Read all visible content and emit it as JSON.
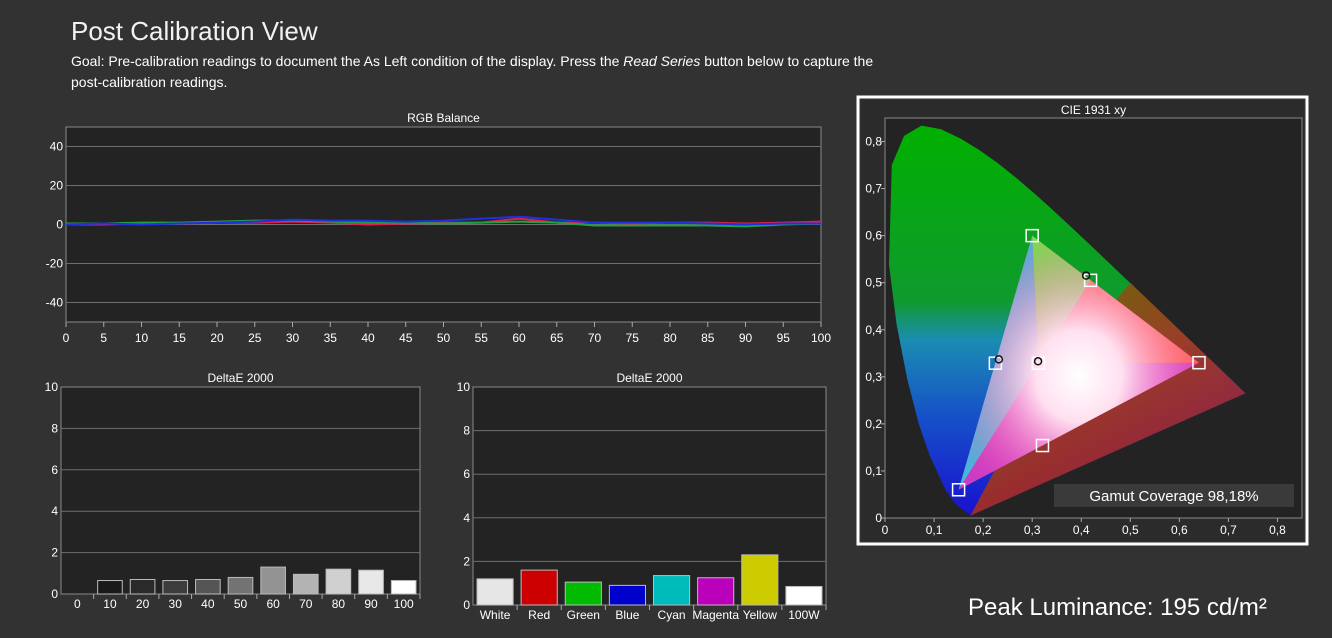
{
  "header": {
    "title": "Post Calibration View",
    "goal_prefix": "Goal: Pre-calibration readings to document the As Left condition of the display. Press the ",
    "goal_italic": "Read Series",
    "goal_suffix": " button below to capture the post-calibration readings."
  },
  "peak_luminance": "Peak Luminance: 195 cd/m²",
  "colors": {
    "background": "#323232",
    "plot_background": "#232323",
    "gridline": "#6e6e6e",
    "red_series": "#e0204a",
    "green_series": "#20a040",
    "blue_series": "#2030e0"
  },
  "chart_data": [
    {
      "type": "line",
      "title": "RGB Balance",
      "x": [
        0,
        5,
        10,
        15,
        20,
        25,
        30,
        35,
        40,
        45,
        50,
        55,
        60,
        65,
        70,
        75,
        80,
        85,
        90,
        95,
        100
      ],
      "xticks": [
        "0",
        "5",
        "10",
        "15",
        "20",
        "25",
        "30",
        "35",
        "40",
        "45",
        "50",
        "55",
        "60",
        "65",
        "70",
        "75",
        "80",
        "85",
        "90",
        "95",
        "100"
      ],
      "yticks": [
        "40",
        "20",
        "0",
        "-20",
        "-40"
      ],
      "ylim": [
        -50,
        50
      ],
      "grid": true,
      "series": [
        {
          "color": "#e0204a",
          "values": [
            0,
            0,
            0.5,
            0.5,
            1,
            1,
            1.5,
            1,
            0,
            0.5,
            1,
            1,
            3,
            1,
            1,
            0.5,
            1,
            1,
            0.5,
            1,
            1.5
          ]
        },
        {
          "color": "#20a040",
          "values": [
            0.5,
            0.5,
            1,
            1,
            1.5,
            2,
            2,
            1.5,
            1,
            1,
            0.5,
            1,
            1.5,
            1,
            -0.5,
            -0.5,
            -0.5,
            -0.5,
            -1,
            0,
            0.5
          ]
        },
        {
          "color": "#2030e0",
          "values": [
            0,
            0.5,
            0,
            0.5,
            1,
            1.5,
            2.5,
            2,
            2,
            1.5,
            2,
            3,
            4,
            2.5,
            1,
            1,
            1,
            0.5,
            0,
            0.5,
            0.5
          ]
        }
      ]
    },
    {
      "type": "bar",
      "title": "DeltaE 2000",
      "categories": [
        "0",
        "10",
        "20",
        "30",
        "40",
        "50",
        "60",
        "70",
        "80",
        "90",
        "100"
      ],
      "values": [
        0,
        0.65,
        0.7,
        0.65,
        0.7,
        0.8,
        1.3,
        0.95,
        1.2,
        1.15,
        0.65
      ],
      "bar_colors": [
        "#000000",
        "#1a1a1a",
        "#2a2a2a",
        "#3c3c3c",
        "#555555",
        "#737373",
        "#939393",
        "#b3b3b3",
        "#d0d0d0",
        "#e8e8e8",
        "#ffffff"
      ],
      "yticks": [
        "10",
        "8",
        "6",
        "4",
        "2",
        "0"
      ],
      "ylim": [
        0,
        10
      ],
      "grid": true
    },
    {
      "type": "bar",
      "title": "DeltaE 2000",
      "categories": [
        "White",
        "Red",
        "Green",
        "Blue",
        "Cyan",
        "Magenta",
        "Yellow",
        "100W"
      ],
      "values": [
        1.2,
        1.6,
        1.05,
        0.9,
        1.35,
        1.25,
        2.3,
        0.85
      ],
      "bar_colors": [
        "#e6e6e6",
        "#cc0000",
        "#00bb00",
        "#0000cc",
        "#00bbbb",
        "#bb00bb",
        "#cccc00",
        "#ffffff"
      ],
      "yticks": [
        "10",
        "8",
        "6",
        "4",
        "2",
        "0"
      ],
      "ylim": [
        0,
        10
      ],
      "grid": true
    },
    {
      "type": "scatter",
      "title": "CIE 1931 xy",
      "xlim": [
        0,
        0.85
      ],
      "ylim": [
        0,
        0.85
      ],
      "xticks": [
        "0",
        "0,1",
        "0,2",
        "0,3",
        "0,4",
        "0,5",
        "0,6",
        "0,7",
        "0,8"
      ],
      "yticks": [
        "0,8",
        "0,7",
        "0,6",
        "0,5",
        "0,4",
        "0,3",
        "0,2",
        "0,1",
        "0"
      ],
      "targets": [
        {
          "name": "Red",
          "x": 0.64,
          "y": 0.33
        },
        {
          "name": "Green",
          "x": 0.3,
          "y": 0.6
        },
        {
          "name": "Blue",
          "x": 0.15,
          "y": 0.06
        },
        {
          "name": "White",
          "x": 0.3127,
          "y": 0.329
        },
        {
          "name": "Cyan",
          "x": 0.225,
          "y": 0.329
        },
        {
          "name": "Magenta",
          "x": 0.321,
          "y": 0.154
        },
        {
          "name": "Yellow",
          "x": 0.419,
          "y": 0.505
        }
      ],
      "measured": [
        {
          "x": 0.232,
          "y": 0.337
        },
        {
          "x": 0.312,
          "y": 0.333
        },
        {
          "x": 0.41,
          "y": 0.515
        }
      ],
      "gamut_coverage": "Gamut Coverage 98,18%"
    }
  ]
}
